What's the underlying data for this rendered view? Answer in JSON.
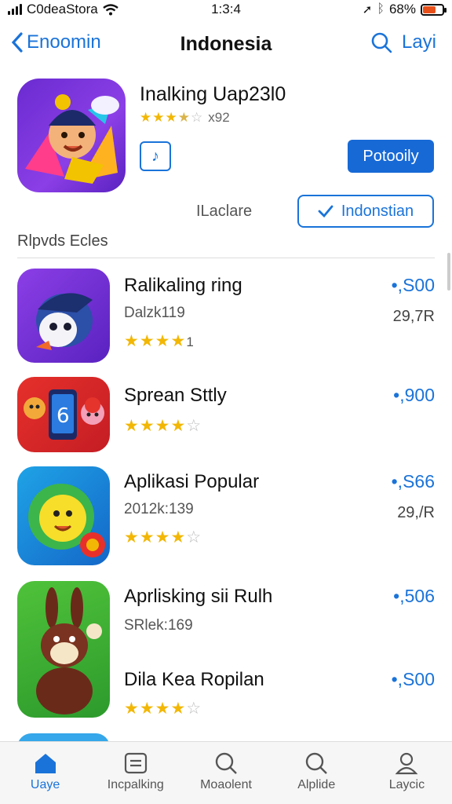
{
  "status_bar": {
    "carrier": "C0deaStora",
    "time": "1:3:4",
    "battery": "68%",
    "battery_level": 0.68
  },
  "nav": {
    "back_label": "Enoomin",
    "title": "Indonesia",
    "right_label": "Layi"
  },
  "featured": {
    "name": "Inalking Uap23l0",
    "rating_count": "x92",
    "stars_filled": 3.5,
    "get_label": "Potooily",
    "section_label": "ILaclare",
    "region_label": "Indonstian"
  },
  "list_header": "Rlpvds Ecles",
  "apps": [
    {
      "name": "Ralikaling ring",
      "sub": "Dalzk119",
      "price": "•,S00",
      "size": "29,7R",
      "rating_suffix": "1"
    },
    {
      "name": "Sprean Sttly",
      "sub": "",
      "price": "•,900",
      "size": "",
      "rating_suffix": ""
    },
    {
      "name": "Aplikasi Popular",
      "sub": "2012k:139",
      "price": "•,S66",
      "size": "29,/R",
      "rating_suffix": ""
    },
    {
      "name": "Aprlisking sii Rulh",
      "sub": "SRlek:169",
      "price": "•,506",
      "size": "",
      "rating_suffix": ""
    },
    {
      "name": "Dila Kea Ropilan",
      "sub": "",
      "price": "•,S00",
      "size": "",
      "rating_suffix": ""
    }
  ],
  "tabs": [
    {
      "label": "Uaye",
      "icon": "home-icon",
      "active": true
    },
    {
      "label": "Incpalking",
      "icon": "list-icon",
      "active": false
    },
    {
      "label": "Moaolent",
      "icon": "search-icon",
      "active": false
    },
    {
      "label": "Alplide",
      "icon": "search-icon",
      "active": false
    },
    {
      "label": "Laycic",
      "icon": "person-icon",
      "active": false
    }
  ],
  "colors": {
    "accent": "#1a73d9",
    "button": "#1769d6",
    "star": "#f2b705"
  }
}
